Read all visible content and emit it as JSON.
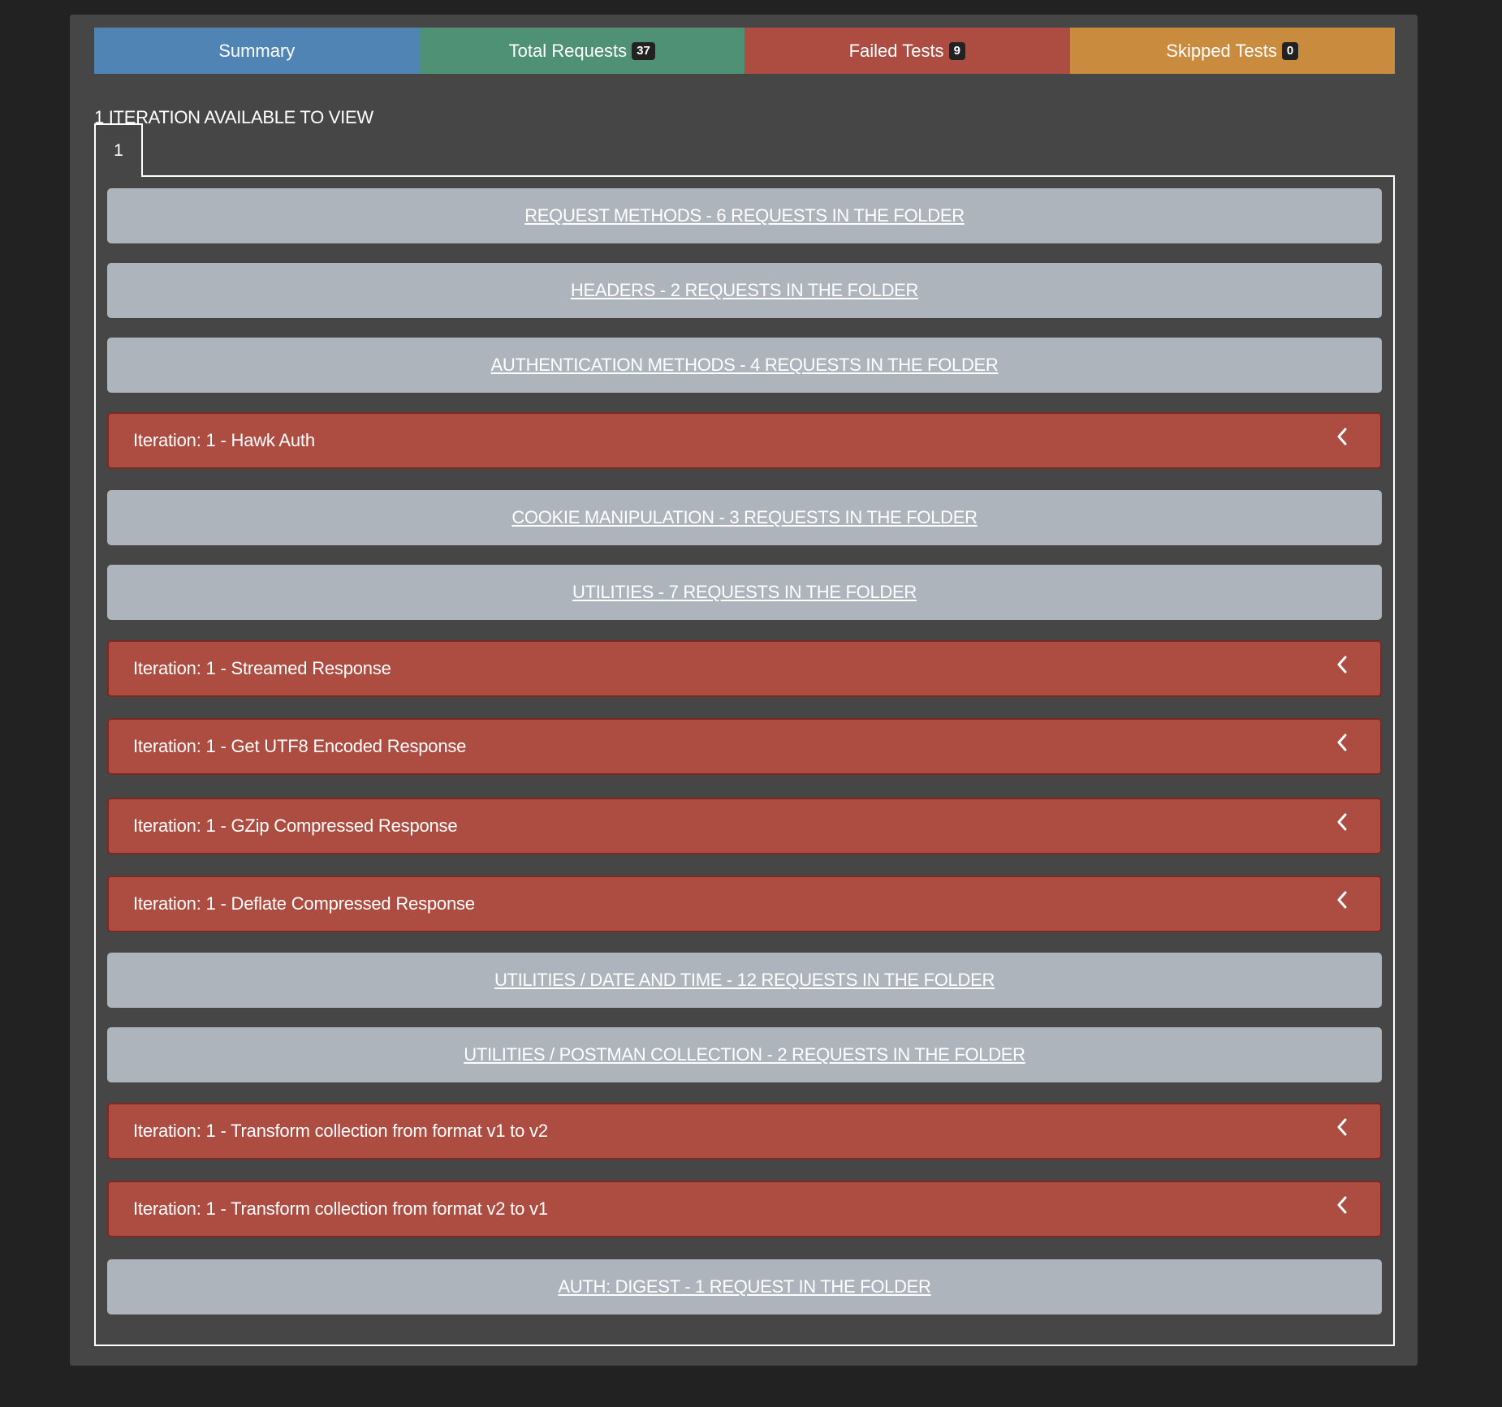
{
  "tabs": {
    "summary": "Summary",
    "total_label": "Total Requests",
    "total_count": "37",
    "failed_label": "Failed Tests",
    "failed_count": "9",
    "skipped_label": "Skipped Tests",
    "skipped_count": "0"
  },
  "colors": {
    "summary": "#4f84b4",
    "total": "#4f9175",
    "failed": "#ad4d42",
    "skipped": "#c98c3f",
    "folder": "#aeb4bb"
  },
  "iterations": {
    "heading": "1 ITERATION AVAILABLE TO VIEW",
    "tab_label": "1"
  },
  "rows": [
    {
      "type": "folder",
      "label": "REQUEST METHODS - 6 REQUESTS IN THE FOLDER"
    },
    {
      "type": "folder",
      "label": "HEADERS - 2 REQUESTS IN THE FOLDER"
    },
    {
      "type": "folder",
      "label": "AUTHENTICATION METHODS - 4 REQUESTS IN THE FOLDER"
    },
    {
      "type": "request",
      "label": "Iteration: 1 - Hawk Auth",
      "icon": "chevron-left-icon"
    },
    {
      "type": "folder",
      "label": "COOKIE MANIPULATION - 3 REQUESTS IN THE FOLDER"
    },
    {
      "type": "folder",
      "label": "UTILITIES - 7 REQUESTS IN THE FOLDER"
    },
    {
      "type": "request",
      "label": "Iteration: 1 - Streamed Response",
      "icon": "chevron-left-icon"
    },
    {
      "type": "request",
      "label": "Iteration: 1 - Get UTF8 Encoded Response",
      "icon": "chevron-left-icon"
    },
    {
      "type": "request",
      "label": "Iteration: 1 - GZip Compressed Response",
      "icon": "chevron-left-icon"
    },
    {
      "type": "request",
      "label": "Iteration: 1 - Deflate Compressed Response",
      "icon": "chevron-left-icon"
    },
    {
      "type": "folder",
      "label": "UTILITIES / DATE AND TIME - 12 REQUESTS IN THE FOLDER"
    },
    {
      "type": "folder",
      "label": "UTILITIES / POSTMAN COLLECTION - 2 REQUESTS IN THE FOLDER"
    },
    {
      "type": "request",
      "label": "Iteration: 1 - Transform collection from format v1 to v2",
      "icon": "chevron-left-icon"
    },
    {
      "type": "request",
      "label": "Iteration: 1 - Transform collection from format v2 to v1",
      "icon": "chevron-left-icon"
    },
    {
      "type": "folder",
      "label": "AUTH: DIGEST - 1 REQUEST IN THE FOLDER"
    }
  ]
}
